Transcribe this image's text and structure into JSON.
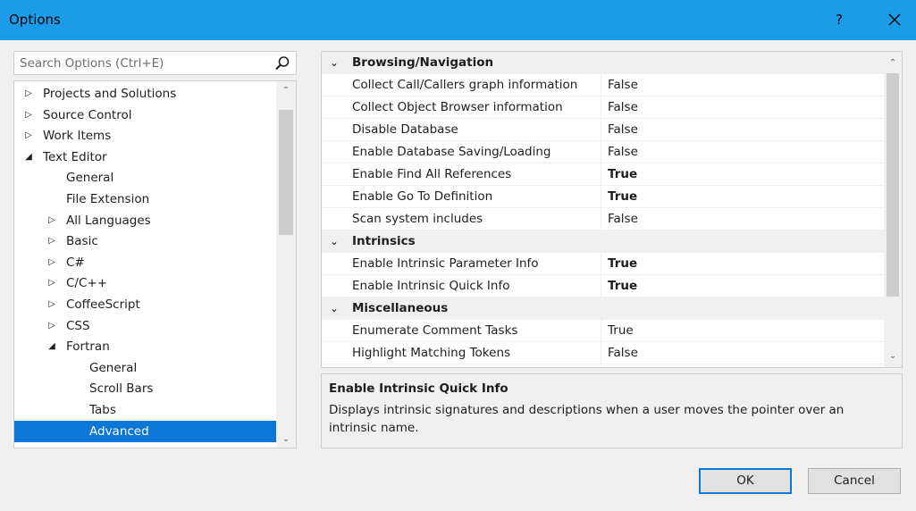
{
  "window": {
    "title": "Options",
    "help_glyph": "?",
    "close_glyph": "✕"
  },
  "search": {
    "placeholder": "Search Options (Ctrl+E)"
  },
  "tree": {
    "items": [
      {
        "label": "Projects and Solutions",
        "expander": "▷"
      },
      {
        "label": "Source Control",
        "expander": "▷"
      },
      {
        "label": "Work Items",
        "expander": "▷"
      },
      {
        "label": "Text Editor",
        "expander": "◢"
      },
      {
        "label": "General",
        "expander": ""
      },
      {
        "label": "File Extension",
        "expander": ""
      },
      {
        "label": "All Languages",
        "expander": "▷"
      },
      {
        "label": "Basic",
        "expander": "▷"
      },
      {
        "label": "C#",
        "expander": "▷"
      },
      {
        "label": "C/C++",
        "expander": "▷"
      },
      {
        "label": "CoffeeScript",
        "expander": "▷"
      },
      {
        "label": "CSS",
        "expander": "▷"
      },
      {
        "label": "Fortran",
        "expander": "◢"
      },
      {
        "label": "General",
        "expander": ""
      },
      {
        "label": "Scroll Bars",
        "expander": ""
      },
      {
        "label": "Tabs",
        "expander": ""
      },
      {
        "label": "Advanced",
        "expander": "",
        "selected": true
      }
    ],
    "scroll_up": "⌃",
    "scroll_down": "⌄"
  },
  "properties": {
    "categories": [
      {
        "name": "Browsing/Navigation",
        "chevron": "⌄",
        "items": [
          {
            "name": "Collect Call/Callers graph information",
            "value": "False",
            "bold": false
          },
          {
            "name": "Collect Object Browser information",
            "value": "False",
            "bold": false
          },
          {
            "name": "Disable Database",
            "value": "False",
            "bold": false
          },
          {
            "name": "Enable Database Saving/Loading",
            "value": "False",
            "bold": false
          },
          {
            "name": "Enable Find All References",
            "value": "True",
            "bold": true
          },
          {
            "name": "Enable Go To Definition",
            "value": "True",
            "bold": true
          },
          {
            "name": "Scan system includes",
            "value": "False",
            "bold": false
          }
        ]
      },
      {
        "name": "Intrinsics",
        "chevron": "⌄",
        "items": [
          {
            "name": "Enable Intrinsic Parameter Info",
            "value": "True",
            "bold": true
          },
          {
            "name": "Enable Intrinsic Quick Info",
            "value": "True",
            "bold": true
          }
        ]
      },
      {
        "name": "Miscellaneous",
        "chevron": "⌄",
        "items": [
          {
            "name": "Enumerate Comment Tasks",
            "value": "True",
            "bold": false
          },
          {
            "name": "Highlight Matching Tokens",
            "value": "False",
            "bold": false
          }
        ]
      }
    ],
    "scroll_up": "⌃",
    "scroll_down": "⌄"
  },
  "description": {
    "title": "Enable Intrinsic Quick Info",
    "text": "Displays intrinsic signatures and descriptions when a user moves the pointer over an intrinsic name."
  },
  "buttons": {
    "ok": "OK",
    "cancel": "Cancel"
  }
}
